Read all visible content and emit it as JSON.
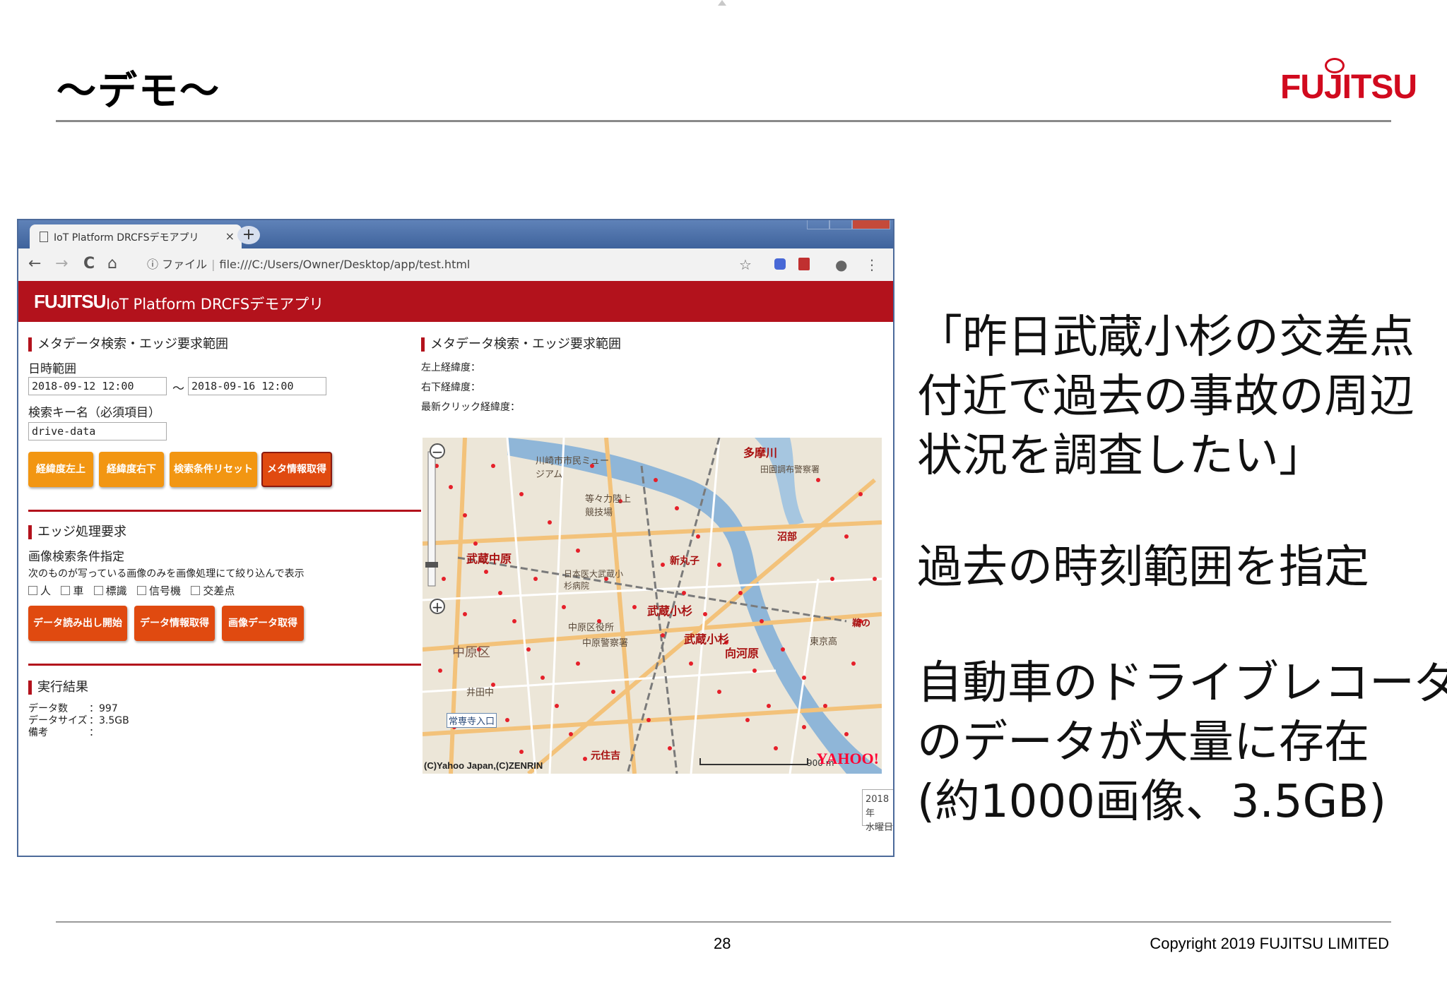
{
  "slide": {
    "title": "～デモ～",
    "logo": "FUJITSU",
    "page_number": "28",
    "copyright": "Copyright 2019 FUJITSU LIMITED",
    "lines": [
      "「昨日武蔵小杉の交差点",
      "付近で過去の事故の周辺",
      "状況を調査したい」",
      "過去の時刻範囲を指定",
      "自動車のドライブレコーダー",
      "のデータが大量に存在",
      "(約1000画像、3.5GB)"
    ]
  },
  "browser": {
    "tab_title": "IoT Platform DRCFSデモアプリ",
    "tab_close": "×",
    "new_tab": "+",
    "nav": {
      "back": "←",
      "forward": "→",
      "reload": "C",
      "home": "⌂"
    },
    "url_info": "ⓘ",
    "url_scheme": "ファイル",
    "url": "file:///C:/Users/Owner/Desktop/app/test.html",
    "star": "☆",
    "menu": "⋮",
    "account": "●"
  },
  "app": {
    "brand": "FUJITSU",
    "name": "IoT Platform DRCFSデモアプリ",
    "meta_section": {
      "title": "メタデータ検索・エッジ要求範囲",
      "date_label": "日時範囲",
      "date_from": "2018-09-12 12:00",
      "date_sep": "～",
      "date_to": "2018-09-16 12:00",
      "key_label": "検索キー名（必須項目）",
      "key_value": "drive-data",
      "buttons": [
        "経緯度左上",
        "経緯度右下",
        "検索条件リセット",
        "メタ情報取得"
      ]
    },
    "edge_section": {
      "title": "エッジ処理要求",
      "cond_label": "画像検索条件指定",
      "cond_desc": "次のものが写っている画像のみを画像処理にて絞り込んで表示",
      "checkboxes": [
        "人",
        "車",
        "標識",
        "信号機",
        "交差点"
      ],
      "buttons": [
        "データ読み出し開始",
        "データ情報取得",
        "画像データ取得"
      ]
    },
    "result_section": {
      "title": "実行結果",
      "rows": [
        {
          "label": "データ数",
          "value": "：997"
        },
        {
          "label": "データサイズ",
          "value": "：3.5GB"
        },
        {
          "label": "備考",
          "value": "："
        }
      ]
    },
    "map_section": {
      "title": "メタデータ検索・エッジ要求範囲",
      "upper_left": "左上経緯度：",
      "lower_right": "右下経緯度：",
      "last_click": "最新クリック経緯度：",
      "stations": [
        "多摩川",
        "武蔵中原",
        "新丸子",
        "武蔵小杉",
        "武蔵小杉",
        "向河原",
        "沼部",
        "元住吉",
        "鵜の"
      ],
      "places": [
        "川崎市市民ミュージアム",
        "等々力陸上競技場",
        "中原区役所",
        "中原区",
        "井田中",
        "常専寺入口",
        "日本医大武蔵小杉病院",
        "中原警察署",
        "東京高",
        "田園調布警察署"
      ],
      "zoom_in": "+",
      "zoom_out": "−",
      "credit": "(C)Yahoo Japan,(C)ZENRIN",
      "yahoo": "YAHOO!",
      "scale": "900 m"
    },
    "tooltip": [
      "2018年",
      "水曜日"
    ]
  }
}
